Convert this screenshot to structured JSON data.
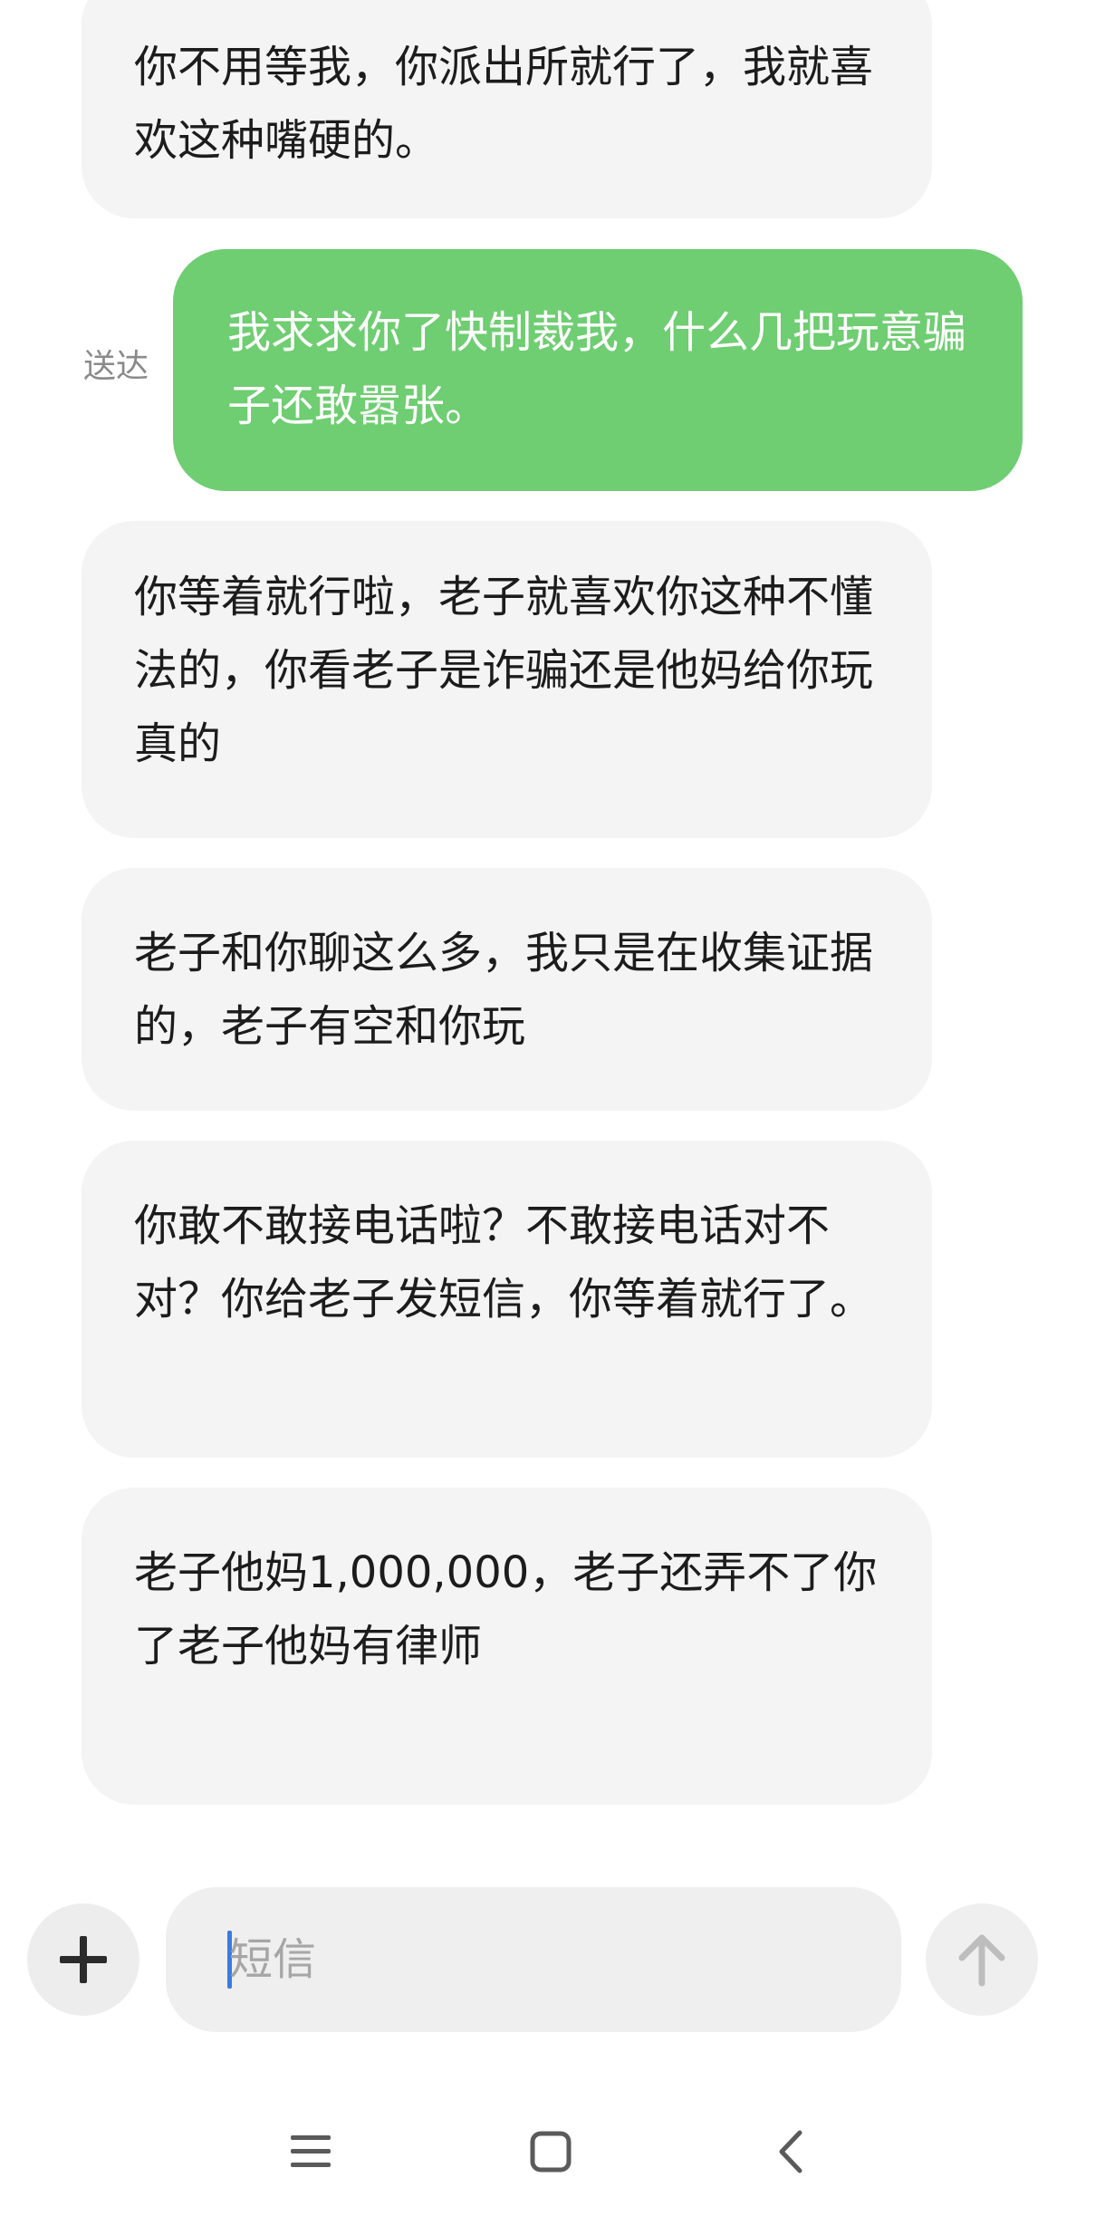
{
  "messages": [
    {
      "direction": "in",
      "text": "你不用等我，你派出所就行了，我就喜欢这种嘴硬的。"
    },
    {
      "direction": "out",
      "text": "我求求你了快制裁我，什么几把玩意骗子还敢嚣张。",
      "status": "送达"
    },
    {
      "direction": "in",
      "text": "你等着就行啦，老子就喜欢你这种不懂法的，你看老子是诈骗还是他妈给你玩真的"
    },
    {
      "direction": "in",
      "text": "老子和你聊这么多，我只是在收集证据的，老子有空和你玩"
    },
    {
      "direction": "in",
      "text": "你敢不敢接电话啦？不敢接电话对不对？你给老子发短信，你等着就行了。"
    },
    {
      "direction": "in",
      "text": "老子他妈1,000,000，老子还弄不了你了老子他妈有律师"
    }
  ],
  "composer": {
    "placeholder": "短信",
    "value": "",
    "add_icon": "plus-icon",
    "send_icon": "arrow-up-icon"
  },
  "navbar": {
    "menu_icon": "menu-icon",
    "home_icon": "home-square-icon",
    "back_icon": "back-chevron-icon"
  },
  "colors": {
    "incoming_bubble": "#f4f4f4",
    "outgoing_bubble": "#6fcd72",
    "caret": "#3a7be0"
  }
}
